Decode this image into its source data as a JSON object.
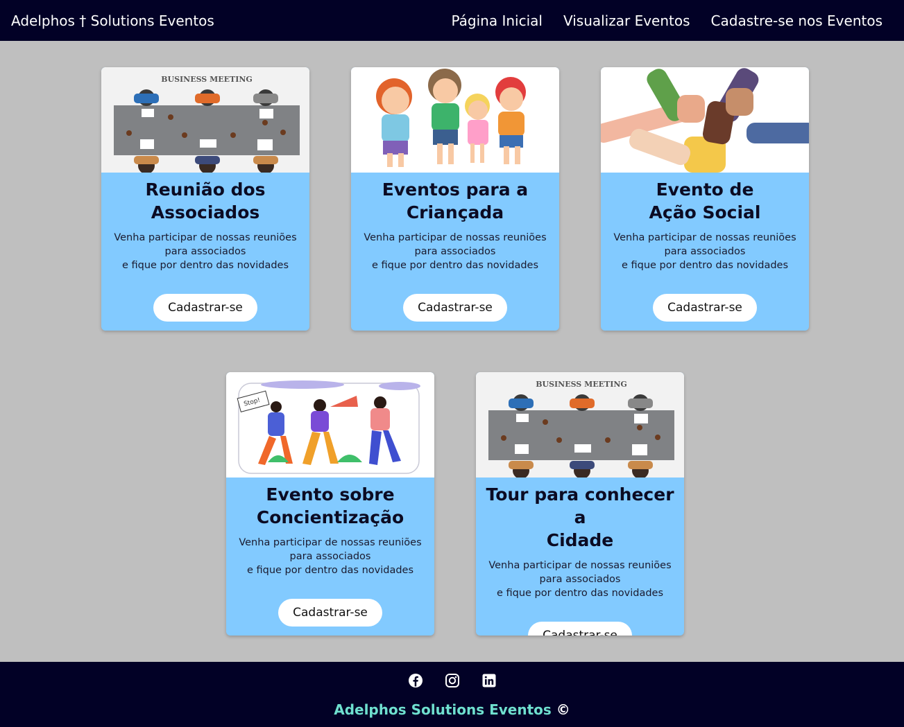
{
  "header": {
    "brand": "Adelphos † Solutions Eventos",
    "nav": [
      {
        "label": "Página Inicial"
      },
      {
        "label": "Visualizar Eventos"
      },
      {
        "label": "Cadastre-se nos Eventos"
      }
    ]
  },
  "image_text": {
    "business_meeting": "BUSINESS MEETING",
    "stop": "Stop!"
  },
  "cards": [
    {
      "title": "Reunião dos Associados",
      "description": "Venha participar de nossas reuniões para associados\ne fique por dentro das novidades",
      "button": "Cadastrar-se",
      "image": "business-meeting"
    },
    {
      "title": "Eventos para a Criançada",
      "description": "Venha participar de nossas reuniões para associados\ne fique por dentro das novidades",
      "button": "Cadastrar-se",
      "image": "children"
    },
    {
      "title": "Evento de\nAção Social",
      "description": "Venha participar de nossas reuniões para associados\ne fique por dentro das novidades",
      "button": "Cadastrar-se",
      "image": "hands"
    },
    {
      "title": "Evento sobre\nConcientização",
      "description": "Venha participar de nossas reuniões para associados\ne fique por dentro das novidades",
      "button": "Cadastrar-se",
      "image": "protest"
    },
    {
      "title": "Tour para conhecer a\nCidade",
      "description": "Venha participar de nossas reuniões para associados\ne fique por dentro das novidades",
      "button": "Cadastrar-se",
      "image": "business-meeting"
    }
  ],
  "footer": {
    "socials": [
      {
        "icon": "facebook-icon"
      },
      {
        "icon": "instagram-icon"
      },
      {
        "icon": "linkedin-icon"
      }
    ],
    "text": "Adelphos Solutions Eventos",
    "copyright": "©"
  }
}
